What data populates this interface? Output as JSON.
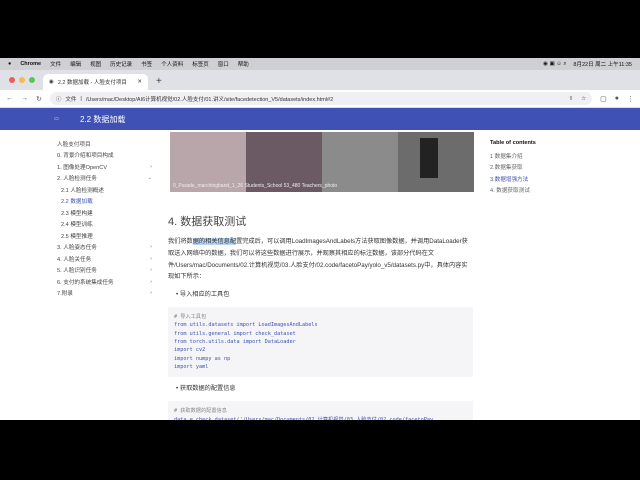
{
  "menubar": {
    "app": "Chrome",
    "items": [
      "文件",
      "编辑",
      "视图",
      "历史记录",
      "书签",
      "个人资料",
      "标签页",
      "窗口",
      "帮助"
    ],
    "clock": "8月22日 周二 上午11:35"
  },
  "tab": {
    "title": "2.2 数据加载 - 人脸支付项目"
  },
  "address": {
    "prefix": "文件",
    "url": "/Users/mac/Desktop/AI6计算机视觉/02.人脸支付/01.讲义/site/facedetection_V5/datasets/index.html#2"
  },
  "header": {
    "title": "2.2 数据加载"
  },
  "nav": {
    "items": [
      {
        "label": "人脸支付项目",
        "level": 0,
        "chev": ""
      },
      {
        "label": "0. 背景介绍和项目构成",
        "level": 0,
        "chev": ""
      },
      {
        "label": "1. 图像处理OpenCV",
        "level": 0,
        "chev": "›"
      },
      {
        "label": "2. 人脸检测任务",
        "level": 0,
        "chev": "⌄"
      },
      {
        "label": "2.1 人脸检测概述",
        "level": 1,
        "chev": ""
      },
      {
        "label": "2.2 数据加载",
        "level": 1,
        "chev": "",
        "active": true
      },
      {
        "label": "2.3 模型构建",
        "level": 1,
        "chev": ""
      },
      {
        "label": "2.4 模型训练",
        "level": 1,
        "chev": ""
      },
      {
        "label": "2.5 模型推理",
        "level": 1,
        "chev": ""
      },
      {
        "label": "3. 人脸姿态任务",
        "level": 0,
        "chev": "›"
      },
      {
        "label": "4. 人脸关任务",
        "level": 0,
        "chev": "›"
      },
      {
        "label": "5. 人脸识别任务",
        "level": 0,
        "chev": "›"
      },
      {
        "label": "6. 支付的系统集成任务",
        "level": 0,
        "chev": "›"
      },
      {
        "label": "7.附录",
        "level": 0,
        "chev": "›"
      }
    ]
  },
  "hero": {
    "caption": "0_Parade_marchingband_1_26  Students_School  53_480  Teachers_photo"
  },
  "main": {
    "heading": "4. 数据获取测试",
    "para_pre": "我们将数",
    "para_hl": "据的相关信息配",
    "para_post": "置完成后，可以调用LoadImagesAndLabels方法获取图像数据，并调用DataLoader获取送入网络中的数据，我们可以将这些数据进行展示，并观察其相应的标注数据，该部分代码在文件/Users/mac/Documents/02.计算机视觉/03.人脸支付/02.code/facetoPay/yolo_v5/datasets.py中，具体内容实现如下所示：",
    "bullet1": "导入相应的工具包",
    "code1": [
      "# 导入工具包",
      "from utils.datasets import LoadImagesAndLabels",
      "from utils.general import check_dataset",
      "from torch.utils.data import DataLoader",
      "import cv2",
      "import numpy as np",
      "import yaml"
    ],
    "bullet2": "获取数据的配置信息",
    "code2": [
      "# 获取数据的配置信息",
      "data = check_dataset('/Users/mac/Documents/02.计算机视觉/03.人脸支付/02.code/facetoPay"
    ]
  },
  "toc": {
    "title": "Table of contents",
    "items": [
      "1 数据集介绍",
      "2.数据集获取",
      "3.数据增强方法",
      "4. 数据获取测试"
    ]
  }
}
